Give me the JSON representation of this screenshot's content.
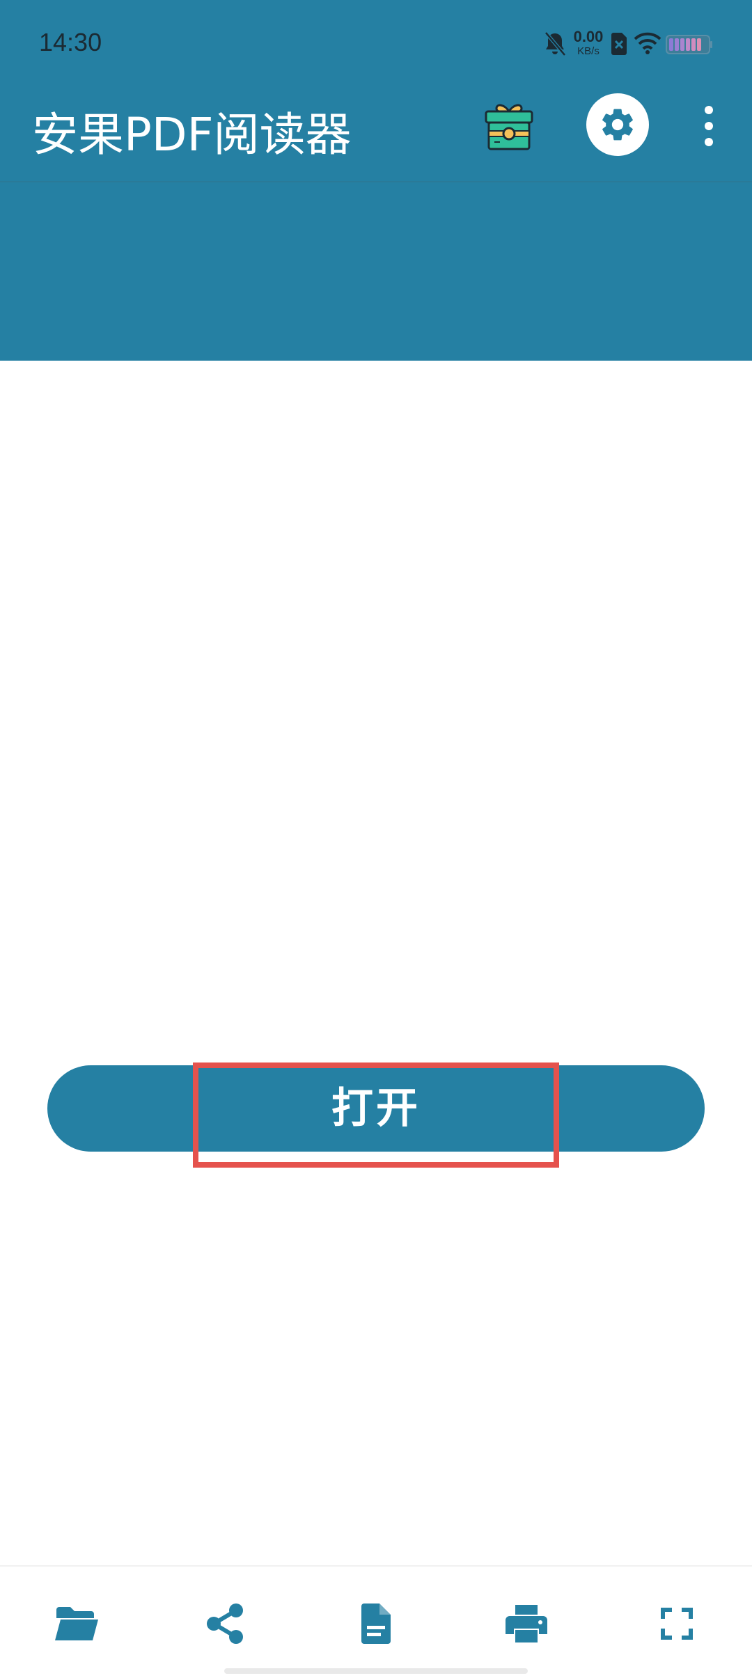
{
  "status_bar": {
    "time": "14:30",
    "net_speed_value": "0.00",
    "net_speed_unit": "KB/s",
    "icons": [
      "bell-muted-icon",
      "sim-off-icon",
      "wifi-icon",
      "battery-icon"
    ]
  },
  "app_bar": {
    "title": "安果PDF阅读器",
    "icons": [
      "gift-icon",
      "gear-icon",
      "more-vertical-icon"
    ]
  },
  "main": {
    "open_button_label": "打开"
  },
  "bottom_bar": {
    "icons": [
      "folder-icon",
      "share-icon",
      "document-icon",
      "print-icon",
      "fullscreen-icon"
    ]
  },
  "colors": {
    "primary": "#2580a3",
    "highlight": "#e5524d",
    "background": "#ffffff"
  }
}
